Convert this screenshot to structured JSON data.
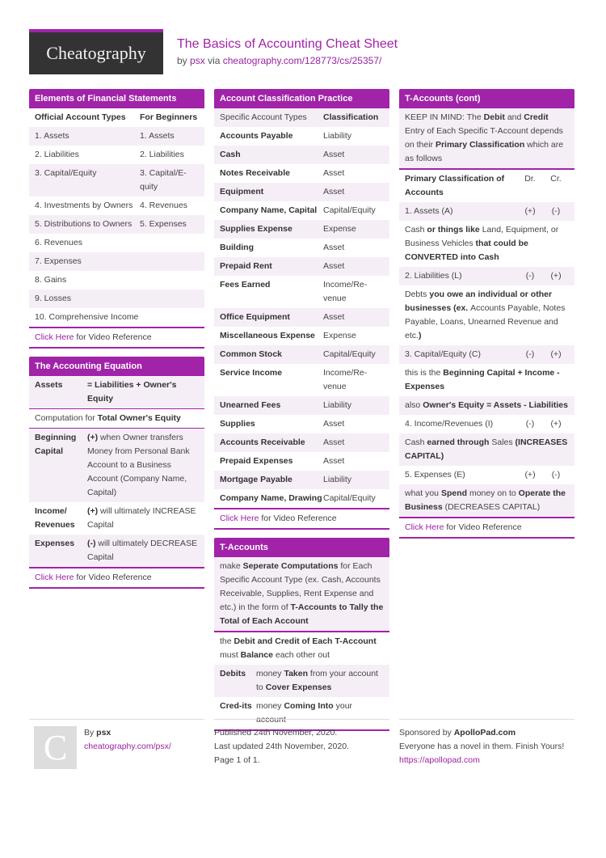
{
  "header": {
    "logo": "Cheatography",
    "title": "The Basics of Accounting Cheat Sheet",
    "by": "by",
    "author": "psx",
    "via": "via",
    "url": "cheatography.com/128773/cs/25357/"
  },
  "elements": {
    "title": "Elements of Financial Statements",
    "head": [
      "Official Account Types",
      "For Beginners"
    ],
    "rows": [
      [
        "1. Assets",
        "1. Assets"
      ],
      [
        "2. Liabilities",
        "2. Liabilities"
      ],
      [
        "3. Capital/Equity",
        "3. Capital/E-quity"
      ],
      [
        "4. Investments by Owners",
        "4. Revenues"
      ],
      [
        "5. Distributions to Owners",
        "5. Expenses"
      ],
      [
        "6. Revenues",
        ""
      ],
      [
        "7. Expenses",
        ""
      ],
      [
        "8. Gains",
        ""
      ],
      [
        "9. Losses",
        ""
      ],
      [
        "10. Comprehensive Income",
        ""
      ]
    ],
    "link": "Click Here",
    "link_suffix": " for Video Reference"
  },
  "equation": {
    "title": "The Accounting Equation",
    "assets_k": "Assets",
    "assets_v": "= Liabilities + Owner's Equity",
    "comp_pre": "Computation for ",
    "comp_b": "Total Owner's Equity",
    "rows": [
      {
        "k": "Beginning Capital",
        "b": "(+)",
        "v": " when Owner transfers Money from Personal Bank Account to a Business Account (Company Name, Capital)"
      },
      {
        "k": "Income/ Revenues",
        "b": "(+)",
        "v": " will ultimately INCREASE Capital"
      },
      {
        "k": "Expenses",
        "b": "(-)",
        "v": " will ultimately DECREASE Capital"
      }
    ],
    "link": "Click Here",
    "link_suffix": " for Video Reference"
  },
  "classification": {
    "title": "Account Classification Practice",
    "head": [
      "Specific Account Types",
      "Classification"
    ],
    "rows": [
      [
        "Accounts Payable",
        "Liability"
      ],
      [
        "Cash",
        "Asset"
      ],
      [
        "Notes Receivable",
        "Asset"
      ],
      [
        "Equipment",
        "Asset"
      ],
      [
        "Company Name, Capital",
        "Capital/Equity"
      ],
      [
        "Supplies Expense",
        "Expense"
      ],
      [
        "Building",
        "Asset"
      ],
      [
        "Prepaid Rent",
        "Asset"
      ],
      [
        "Fees Earned",
        "Income/Re-venue"
      ],
      [
        "Office Equipment",
        "Asset"
      ],
      [
        "Miscellaneous Expense",
        "Expense"
      ],
      [
        "Common Stock",
        "Capital/Equity"
      ],
      [
        "Service Income",
        "Income/Re-venue"
      ],
      [
        "Unearned Fees",
        "Liability"
      ],
      [
        "Supplies",
        "Asset"
      ],
      [
        "Accounts Receivable",
        "Asset"
      ],
      [
        "Prepaid Expenses",
        "Asset"
      ],
      [
        "Mortgage Payable",
        "Liability"
      ],
      [
        "Company Name, Drawing",
        "Capital/Equity"
      ]
    ],
    "link": "Click Here",
    "link_suffix": " for Video Reference"
  },
  "taccounts": {
    "title": "T-Accounts",
    "p1": [
      "make ",
      "Seperate Computations",
      " for Each Specific Account Type (ex. Cash, Accounts Receivable, Supplies, Rent Expense and etc.) in the form of ",
      "T-Accounts to Tally the Total of Each Account"
    ],
    "p2": [
      "the ",
      "Debit and Credit of Each T-Account",
      " must ",
      "Balance",
      " each other out"
    ],
    "debits_k": "Debits",
    "debits_v": [
      "money ",
      "Taken",
      " from your account to ",
      "Cover Expenses"
    ],
    "credits_k": "Cred-its",
    "credits_v": [
      "money ",
      "Coming Into",
      " your account"
    ]
  },
  "tcont": {
    "title": "T-Accounts (cont)",
    "keep": [
      "KEEP IN MIND: The ",
      "Debit",
      " and ",
      "Credit",
      " Entry of Each Specific T-Account depends on their ",
      "Primary Classification",
      " which are as follows"
    ],
    "head": [
      "Primary Classification of Accounts",
      "Dr.",
      "Cr."
    ],
    "assets": [
      "1. Assets (A)",
      "(+)",
      "(-)"
    ],
    "assets_desc": [
      "Cash",
      " or things like ",
      "Land, Equipment, or Business Vehicles",
      " that could be CONVERTED into Cash"
    ],
    "liab": [
      "2. Liabilities (L)",
      "(-)",
      "(+)"
    ],
    "liab_desc": [
      "Debts",
      " you owe an individual or other businesses (ex. ",
      "Accounts Payable, Notes Payable, Loans, Unearned Revenue and etc.",
      ")"
    ],
    "cap": [
      "3. Capital/Equity (C)",
      "(-)",
      "(+)"
    ],
    "cap_desc": [
      "this is the ",
      "Beginning Capital + Income - Expenses"
    ],
    "cap_desc2": [
      "also ",
      "Owner's Equity = Assets - Liabilities"
    ],
    "inc": [
      "4. Income/Revenues (I)",
      "(-)",
      "(+)"
    ],
    "inc_desc": [
      "Cash",
      " earned through ",
      "Sales",
      " (INCREASES CAPITAL)"
    ],
    "exp": [
      "5. Expenses (E)",
      "(+)",
      "(-)"
    ],
    "exp_desc": [
      "what you ",
      "Spend",
      " money on to ",
      "Operate the Business",
      " (DECREASES CAPITAL)"
    ],
    "link": "Click Here",
    "link_suffix": " for Video Reference"
  },
  "footer": {
    "avatar": "C",
    "by": "By ",
    "author": "psx",
    "author_url": "cheatography.com/psx/",
    "published": "Published 24th November, 2020.",
    "updated": "Last updated 24th November, 2020.",
    "page": "Page 1 of 1.",
    "sponsor_pre": "Sponsored by ",
    "sponsor": "ApolloPad.com",
    "sponsor_text": "Everyone has a novel in them. Finish Yours!",
    "sponsor_url": "https://apollopad.com"
  }
}
